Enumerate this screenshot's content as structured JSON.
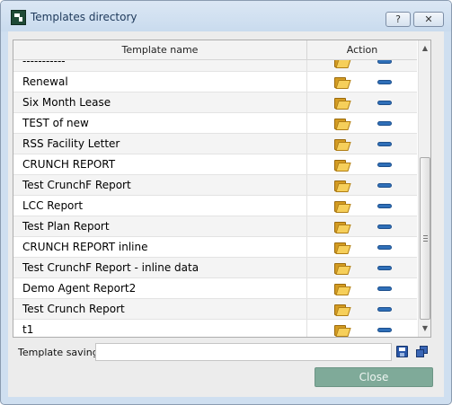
{
  "window": {
    "title": "Templates directory",
    "help_label": "?",
    "close_label": "✕"
  },
  "grid": {
    "columns": [
      "Template name",
      "Action"
    ],
    "rows": [
      {
        "name": "-----------"
      },
      {
        "name": "Renewal"
      },
      {
        "name": "Six Month Lease"
      },
      {
        "name": "TEST of new"
      },
      {
        "name": "RSS Facility Letter"
      },
      {
        "name": "CRUNCH REPORT"
      },
      {
        "name": "Test CrunchF Report"
      },
      {
        "name": "LCC Report"
      },
      {
        "name": "Test Plan Report"
      },
      {
        "name": "CRUNCH REPORT inline"
      },
      {
        "name": "Test CrunchF Report - inline data"
      },
      {
        "name": "Demo Agent Report2"
      },
      {
        "name": "Test Crunch Report"
      },
      {
        "name": "t1"
      }
    ],
    "row_icons": [
      "open-folder-icon",
      "remove-icon"
    ],
    "scroll": {
      "up_label": "▲",
      "down_label": "▼"
    }
  },
  "footer": {
    "save_label": "Template saving",
    "save_value": "",
    "save_icon": "save-icon",
    "save_all_icon": "save-all-icon",
    "close_label": "Close"
  },
  "colors": {
    "remove_icon": "#2f6fb8",
    "close_button": "#7faa99",
    "folder": "#f6cf5a"
  }
}
